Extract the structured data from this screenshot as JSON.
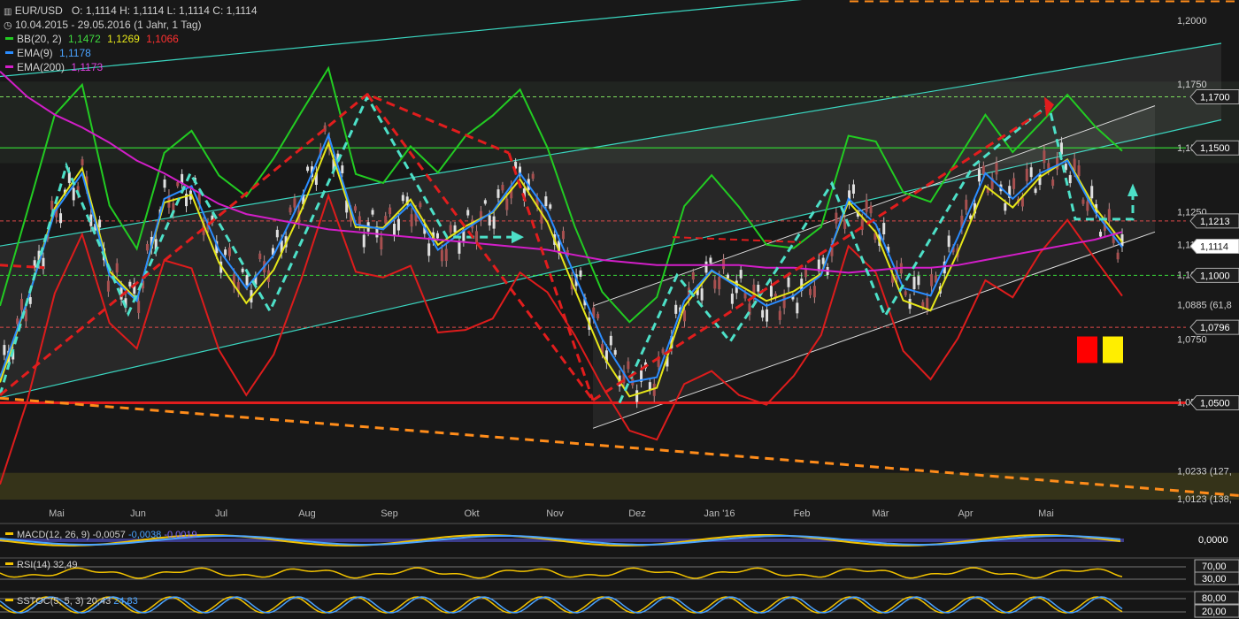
{
  "header": {
    "symbol": "EUR/USD",
    "ohlc": "O: 1,1114  H: 1,1114  L: 1,1114  C: 1,1114",
    "period": "10.04.2015 - 29.05.2016 (1 Jahr, 1 Tag)",
    "bb_label": "BB(20, 2)",
    "bb_mid": "1,1472",
    "bb_upper": "1,1269",
    "bb_lower": "1,1066",
    "ema9_label": "EMA(9)",
    "ema9_value": "1,1178",
    "ema200_label": "EMA(200)",
    "ema200_value": "1,1173"
  },
  "colors": {
    "background": "#181818",
    "bb_green": "#22cc22",
    "bb_yellow": "#e6e619",
    "bb_red": "#dd1c1c",
    "ema9": "#2a8cff",
    "ema200": "#d21ec8",
    "channel": "#3ad6c0",
    "trend_red": "#e11d1d",
    "trend_orange": "#ff8c1a",
    "macd": "#4aa3ff",
    "signal": "#f2c200",
    "histogram": "#7f6bff"
  },
  "chart_data": {
    "type": "line",
    "ylim": [
      1.012,
      1.208
    ],
    "x_labels": [
      "Mai",
      "Jun",
      "Jul",
      "Aug",
      "Sep",
      "Okt",
      "Nov",
      "Dez",
      "Jan '16",
      "Feb",
      "Mär",
      "Apr",
      "Mai"
    ],
    "axis_ticks": [
      {
        "label": "1,2000",
        "value": 1.2
      },
      {
        "label": "1,1750",
        "value": 1.175
      },
      {
        "label": "1,1501 (0,00",
        "value": 1.1501
      },
      {
        "label": "1,1250",
        "value": 1.125
      },
      {
        "label": "1,1120 (38,2",
        "value": 1.112
      },
      {
        "label": "1,1003 (50,0",
        "value": 1.1003
      },
      {
        "label": "1,0885 (61,8",
        "value": 1.0885
      },
      {
        "label": "1,0750",
        "value": 1.075
      },
      {
        "label": "1,0504 (100",
        "value": 1.0504
      },
      {
        "label": "1,0233 (127,",
        "value": 1.0233
      },
      {
        "label": "1,0123 (138,",
        "value": 1.0123
      }
    ],
    "price_boxes": [
      {
        "label": "1,1700",
        "value": 1.17
      },
      {
        "label": "1,1500",
        "value": 1.15
      },
      {
        "label": "1,1213",
        "value": 1.1213
      },
      {
        "label": "1,1114",
        "value": 1.1114,
        "highlight": true
      },
      {
        "label": "1,1000",
        "value": 1.1
      },
      {
        "label": "1,0796",
        "value": 1.0796
      },
      {
        "label": "1,0500",
        "value": 1.05
      }
    ],
    "series": [
      {
        "name": "EMA(9)",
        "values": [
          1.06,
          1.09,
          1.125,
          1.14,
          1.1,
          1.09,
          1.13,
          1.135,
          1.11,
          1.095,
          1.108,
          1.13,
          1.155,
          1.12,
          1.118,
          1.128,
          1.11,
          1.118,
          1.125,
          1.14,
          1.125,
          1.1,
          1.075,
          1.058,
          1.06,
          1.09,
          1.102,
          1.095,
          1.088,
          1.092,
          1.1,
          1.13,
          1.12,
          1.095,
          1.092,
          1.115,
          1.14,
          1.13,
          1.14,
          1.145,
          1.125,
          1.111
        ]
      },
      {
        "name": "EMA(200)",
        "values": [
          1.18,
          1.17,
          1.163,
          1.158,
          1.152,
          1.145,
          1.14,
          1.134,
          1.128,
          1.124,
          1.122,
          1.12,
          1.118,
          1.117,
          1.116,
          1.115,
          1.114,
          1.113,
          1.112,
          1.111,
          1.11,
          1.108,
          1.106,
          1.105,
          1.104,
          1.104,
          1.104,
          1.104,
          1.103,
          1.103,
          1.102,
          1.101,
          1.102,
          1.103,
          1.103,
          1.104,
          1.106,
          1.108,
          1.11,
          1.112,
          1.114,
          1.117
        ]
      }
    ]
  },
  "subpanels": {
    "macd_label": "MACD(12, 26, 9)",
    "macd_value": "-0,0057",
    "macd_value2": "-0,0038",
    "macd_value3": "-0,0019",
    "macd_axis": "0,0000",
    "rsi_label": "RSI(14)",
    "rsi_value": "32,49",
    "rsi_upper": "70,00",
    "rsi_lower": "30,00",
    "stoch_label": "SSTOC(5, 5, 3)",
    "stoch_value": "20,43",
    "stoch_value2": "24,83",
    "stoch_upper": "80,00",
    "stoch_lower": "20,00"
  }
}
